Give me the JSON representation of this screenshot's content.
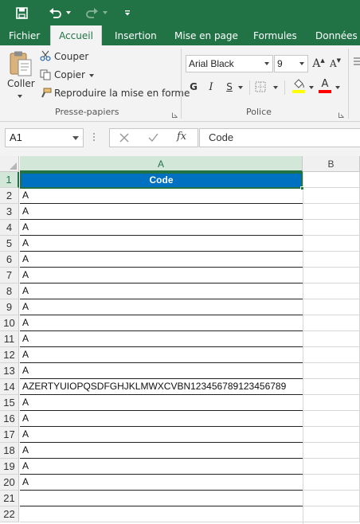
{
  "qat": {
    "save_icon": "save-icon",
    "undo_icon": "undo-icon",
    "redo_icon": "redo-icon",
    "customize_icon": "customize-qat-icon"
  },
  "tabs": [
    "Fichier",
    "Accueil",
    "Insertion",
    "Mise en page",
    "Formules",
    "Données"
  ],
  "active_tab": "Accueil",
  "ribbon": {
    "clipboard": {
      "paste_label": "Coller",
      "cut_label": "Couper",
      "copy_label": "Copier",
      "format_painter_label": "Reproduire la mise en forme",
      "group_label": "Presse-papiers"
    },
    "font": {
      "font_name": "Arial Black",
      "font_size": "9",
      "grow_label": "A",
      "shrink_label": "A",
      "bold_label": "G",
      "italic_label": "I",
      "underline_label": "S",
      "font_color_label": "A",
      "group_label": "Police",
      "highlight_color": "#ffff00",
      "font_color": "#ff0000"
    }
  },
  "formula_bar": {
    "name_box": "A1",
    "fx_label": "fx",
    "value": "Code"
  },
  "grid": {
    "columns": [
      "A",
      "B"
    ],
    "rows": [
      {
        "num": "1",
        "a": "Code"
      },
      {
        "num": "2",
        "a": "A"
      },
      {
        "num": "3",
        "a": "A"
      },
      {
        "num": "4",
        "a": "A"
      },
      {
        "num": "5",
        "a": "A"
      },
      {
        "num": "6",
        "a": "A"
      },
      {
        "num": "7",
        "a": "A"
      },
      {
        "num": "8",
        "a": "A"
      },
      {
        "num": "9",
        "a": "A"
      },
      {
        "num": "10",
        "a": "A"
      },
      {
        "num": "11",
        "a": "A"
      },
      {
        "num": "12",
        "a": "A"
      },
      {
        "num": "13",
        "a": "A"
      },
      {
        "num": "14",
        "a": "AZERTYUIOPQSDFGHJKLMWXCVBN123456789123456789"
      },
      {
        "num": "15",
        "a": "A"
      },
      {
        "num": "16",
        "a": "A"
      },
      {
        "num": "17",
        "a": "A"
      },
      {
        "num": "18",
        "a": "A"
      },
      {
        "num": "19",
        "a": "A"
      },
      {
        "num": "20",
        "a": "A"
      },
      {
        "num": "21",
        "a": ""
      },
      {
        "num": "22",
        "a": ""
      }
    ]
  },
  "colors": {
    "accent": "#217346",
    "header_fill": "#0070c0"
  }
}
